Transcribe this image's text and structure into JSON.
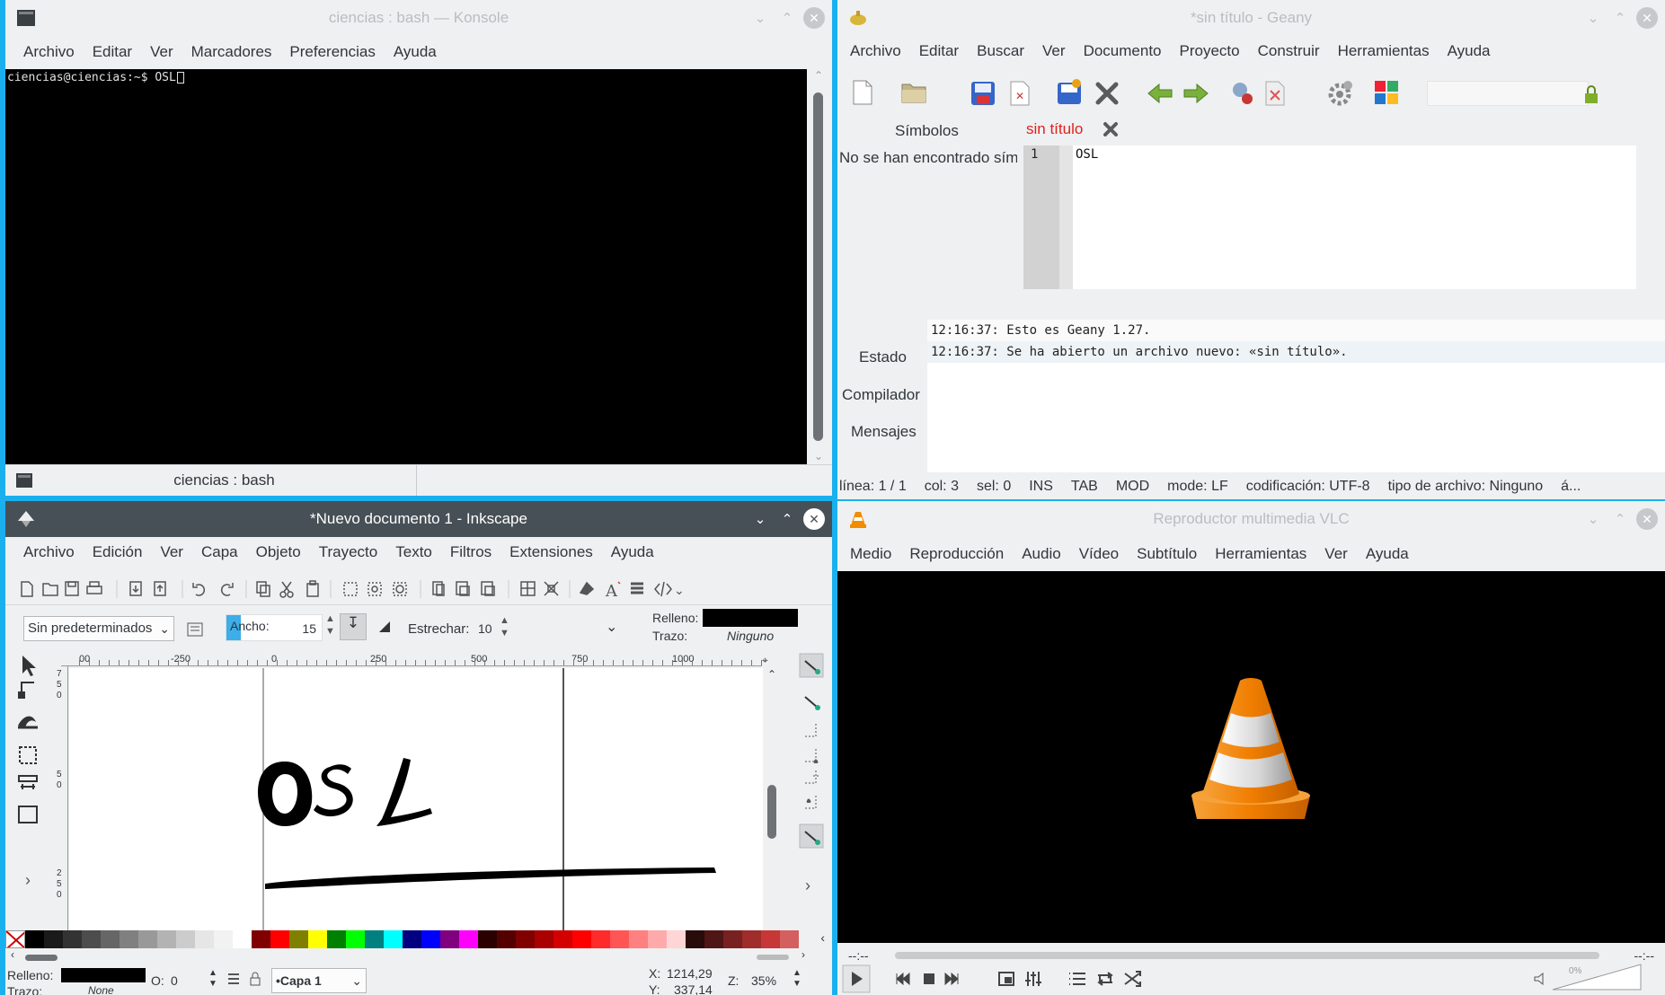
{
  "konsole": {
    "title": "ciencias : bash — Konsole",
    "menu": [
      "Archivo",
      "Editar",
      "Ver",
      "Marcadores",
      "Preferencias",
      "Ayuda"
    ],
    "terminal_line": "ciencias@ciencias:~$ OSL",
    "tab_label": "ciencias : bash"
  },
  "geany": {
    "title": "*sin título - Geany",
    "menu": [
      "Archivo",
      "Editar",
      "Buscar",
      "Ver",
      "Documento",
      "Proyecto",
      "Construir",
      "Herramientas",
      "Ayuda"
    ],
    "sidebar_tab": "Símbolos",
    "doc_tab": "sin título",
    "no_symbols": "No se han encontrado sím",
    "line_number": "1",
    "code": "OSL",
    "log": [
      "12:16:37: Esto es Geany 1.27.",
      "12:16:37: Se ha abierto un archivo nuevo: «sin título»."
    ],
    "msg_tabs": [
      "Estado",
      "Compilador",
      "Mensajes"
    ],
    "status": [
      "línea: 1 / 1",
      "col: 3",
      "sel: 0",
      "INS",
      "TAB",
      "MOD",
      "mode: LF",
      "codificación: UTF-8",
      "tipo de archivo: Ninguno",
      "á..."
    ]
  },
  "inkscape": {
    "title": "*Nuevo documento 1 - Inkscape",
    "menu": [
      "Archivo",
      "Edición",
      "Ver",
      "Capa",
      "Objeto",
      "Trayecto",
      "Texto",
      "Filtros",
      "Extensiones",
      "Ayuda"
    ],
    "preset": "Sin predeterminados",
    "width_label": "Ancho:",
    "width_value": "15",
    "thin_label": "Estrechar:",
    "thin_value": "10",
    "fill_label": "Relleno:",
    "stroke_label": "Trazo:",
    "stroke_value": "Ninguno",
    "ruler": [
      "00",
      "-250",
      "0",
      "250",
      "500",
      "750",
      "1000"
    ],
    "vruler": [
      "7",
      "5",
      "0",
      "5",
      "0",
      "2",
      "5",
      "0"
    ],
    "bottom_fill": "Relleno:",
    "bottom_stroke": "Trazo:",
    "bottom_stroke_value": "None",
    "opacity_label": "O:",
    "opacity_value": "0",
    "layer": "•Capa 1",
    "coord_x": "X:",
    "coord_x_value": "1214,29",
    "coord_y": "Y:",
    "coord_y_value": "337,14",
    "zoom_label": "Z:",
    "zoom_value": "35%",
    "palette": [
      "#000000",
      "#1a1a1a",
      "#333333",
      "#4d4d4d",
      "#666666",
      "#808080",
      "#999999",
      "#b3b3b3",
      "#cccccc",
      "#e6e6e6",
      "#f2f2f2",
      "#ffffff",
      "#800000",
      "#ff0000",
      "#808000",
      "#ffff00",
      "#008000",
      "#00ff00",
      "#008080",
      "#00ffff",
      "#000080",
      "#0000ff",
      "#800080",
      "#ff00ff",
      "#2b0000",
      "#550000",
      "#800000",
      "#aa0000",
      "#d40000",
      "#ff0000",
      "#ff2a2a",
      "#ff5555",
      "#ff8080",
      "#ffaaaa",
      "#ffd5d5",
      "#280b0b",
      "#501616",
      "#782121",
      "#a02c2c",
      "#c83737",
      "#d35f5f"
    ]
  },
  "vlc": {
    "title": "Reproductor multimedia VLC",
    "menu": [
      "Medio",
      "Reproducción",
      "Audio",
      "Vídeo",
      "Subtítulo",
      "Herramientas",
      "Ver",
      "Ayuda"
    ],
    "time_left": "--:--",
    "time_right": "--:--",
    "volume": "0%"
  }
}
